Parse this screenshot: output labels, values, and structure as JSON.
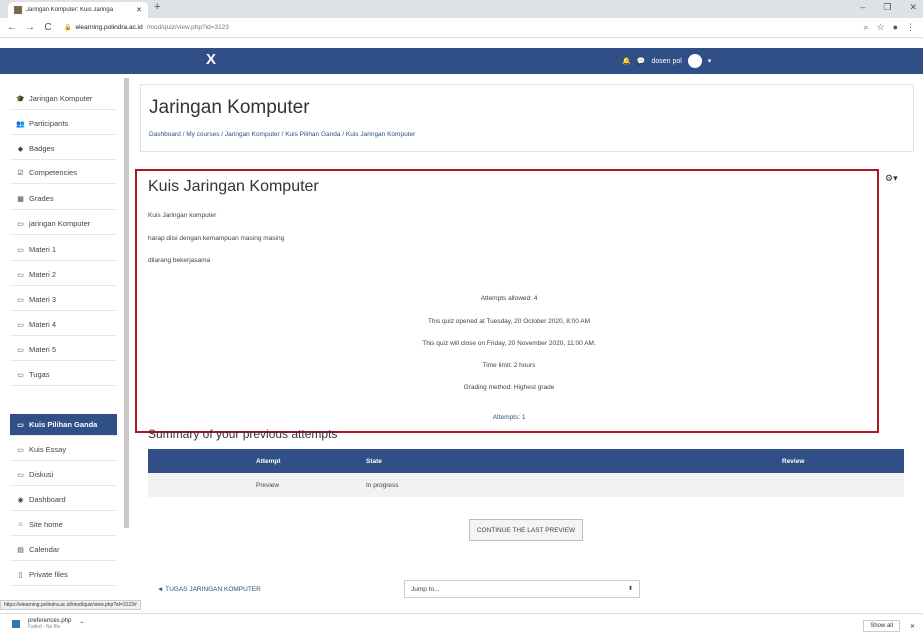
{
  "browser": {
    "tab_title": "Jaringan Komputer: Kuis Jaringa",
    "url_host": "elearning.polindra.ac.id",
    "url_path": "/mod/quiz/view.php?id=3123",
    "status_url": "https://elearning.polindra.ac.id/mod/quiz/view.php?id=3123#"
  },
  "navbar": {
    "close_label": "X",
    "username": "dosen pol"
  },
  "sidebar": {
    "items": [
      {
        "label": "Jaringan Komputer",
        "icon": "mortarboard-icon"
      },
      {
        "label": "Participants",
        "icon": "users-icon"
      },
      {
        "label": "Badges",
        "icon": "badge-icon"
      },
      {
        "label": "Competencies",
        "icon": "checkbox-icon"
      },
      {
        "label": "Grades",
        "icon": "table-icon"
      },
      {
        "label": "jaringan Komputer",
        "icon": "folder-icon"
      },
      {
        "label": "Materi 1",
        "icon": "folder-icon"
      },
      {
        "label": "Materi 2",
        "icon": "folder-icon"
      },
      {
        "label": "Materi 3",
        "icon": "folder-icon"
      },
      {
        "label": "Materi 4",
        "icon": "folder-icon"
      },
      {
        "label": "Materi 5",
        "icon": "folder-icon"
      },
      {
        "label": "Tugas",
        "icon": "folder-icon"
      },
      {
        "label": "Kuis Pilihan Ganda",
        "icon": "folder-icon"
      },
      {
        "label": "Kuis Essay",
        "icon": "folder-icon"
      },
      {
        "label": "Diskusi",
        "icon": "folder-icon"
      },
      {
        "label": "Dashboard",
        "icon": "dashboard-icon"
      },
      {
        "label": "Site home",
        "icon": "home-icon"
      },
      {
        "label": "Calendar",
        "icon": "calendar-icon"
      },
      {
        "label": "Private files",
        "icon": "file-icon"
      }
    ]
  },
  "header": {
    "title": "Jaringan Komputer",
    "breadcrumb": "Dashboard / My courses / Jaringan Komputer / Kuis Pilihan Ganda / Kuis Jaringan Komputer"
  },
  "quiz": {
    "title": "Kuis Jaringan Komputer",
    "intro": [
      "Kuis Jaringan komputer",
      "harap diisi dengan kemampuan masing masing",
      "dilarang bekerjasama"
    ],
    "attempts_allowed": "Attempts allowed: 4",
    "opened": "This quiz opened at Tuesday, 20 October 2020, 8:00 AM",
    "close": "This quiz will close on Friday, 20 November 2020, 11:00 AM.",
    "time_limit": "Time limit: 2 hours",
    "grading": "Grading method: Highest grade",
    "attempts": "Attempts: 1"
  },
  "summary": {
    "title": "Summary of your previous attempts",
    "headers": {
      "attempt": "Attempt",
      "state": "State",
      "review": "Review"
    },
    "row": {
      "attempt": "Preview",
      "state": "In progress"
    }
  },
  "actions": {
    "continue": "CONTINUE THE LAST PREVIEW",
    "prev_link": "◄ TUGAS JARINGAN KOMPUTER",
    "jump_placeholder": "Jump to..."
  },
  "downloads": {
    "file": "preferences.php",
    "sub": "Failed - No file",
    "show_all": "Show all"
  }
}
